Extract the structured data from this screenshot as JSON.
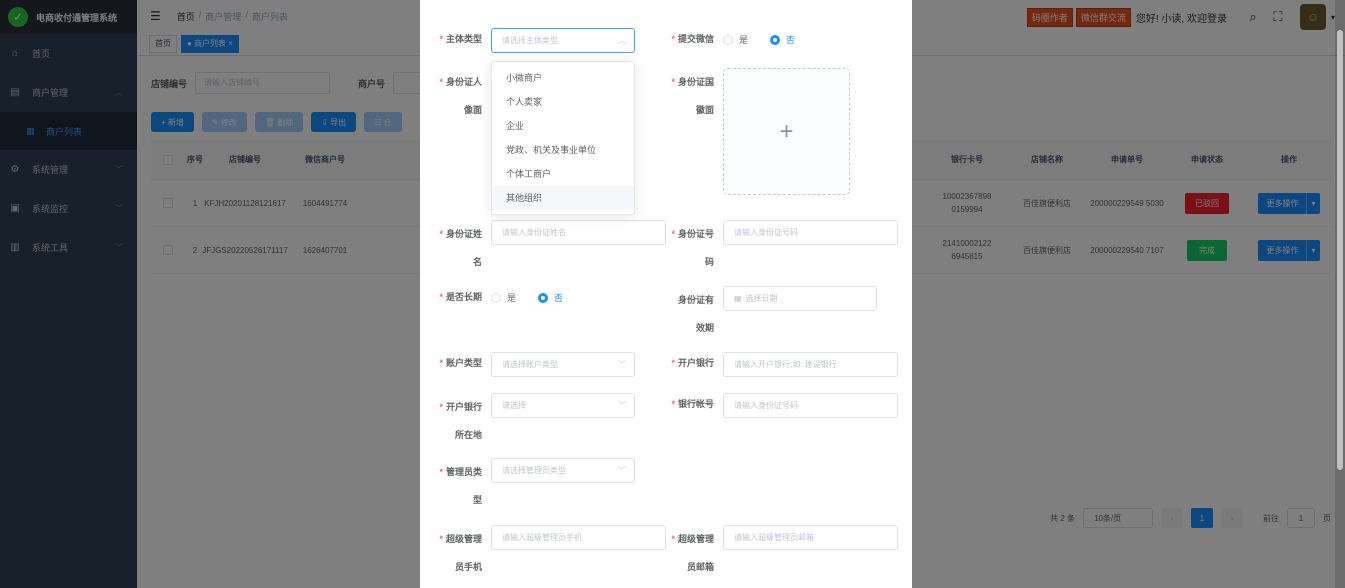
{
  "app": {
    "title": "电商收付通管理系统",
    "logo_glyph": "✓"
  },
  "sidebar": {
    "items": [
      {
        "label": "首页",
        "icon": "⌂",
        "has_arrow": false
      },
      {
        "label": "商户管理",
        "icon": "▤",
        "has_arrow": true
      },
      {
        "label": "系统管理",
        "icon": "⚙",
        "has_arrow": true
      },
      {
        "label": "系统监控",
        "icon": "▣",
        "has_arrow": true
      },
      {
        "label": "系统工具",
        "icon": "▥",
        "has_arrow": true
      }
    ],
    "active_sub": {
      "label": "商户列表",
      "icon": "▦"
    }
  },
  "navbar": {
    "breadcrumb": [
      "首页",
      "/",
      "商户管理",
      "/",
      "商户列表"
    ],
    "tag1": "码圈作者",
    "tag2": "微信群交流",
    "greeting": "您好! 小读, 欢迎登录"
  },
  "tagsview": {
    "home": "首页",
    "active": "● 商户列表 ×"
  },
  "filters": {
    "shop_label": "店铺编号",
    "shop_placeholder": "请输入店铺编号",
    "merchant_label": "商户号"
  },
  "toolbar": {
    "add": "+ 新增",
    "edit": "✎ 修改",
    "delete": "🗑 删除",
    "export": "⇩ 导出",
    "more": "☷ 合"
  },
  "table": {
    "headers": {
      "no": "序号",
      "shop": "店铺编号",
      "wx": "微信商户号",
      "bank": "银行卡号",
      "name": "店铺名称",
      "apply": "申请单号",
      "status": "申请状态",
      "op": "操作"
    },
    "rows": [
      {
        "no": "1",
        "shop": "KFJH20201128121617",
        "wx": "1604491774",
        "bank": "10002367898 0159994",
        "name": "百佳旗便利店",
        "apply": "200000229549 5030",
        "status": "已驳回",
        "status_type": "red",
        "op": "更多操作"
      },
      {
        "no": "2",
        "shop": "JFJGS20220526171117",
        "wx": "1626407701",
        "bank": "21410002122 6945815",
        "name": "百佳旗便利店",
        "apply": "200000229540 7107",
        "status": "完成",
        "status_type": "green",
        "op": "更多操作"
      }
    ]
  },
  "pagination": {
    "total": "共 2 条",
    "size": "10条/页",
    "page": "1",
    "goto_label": "前往",
    "goto_value": "1",
    "goto_unit": "页"
  },
  "dialog": {
    "subject_type": {
      "label": "主体类型",
      "placeholder": "请选择主体类型"
    },
    "submit_wx": {
      "label": "提交微信",
      "yes": "是",
      "no": "否",
      "selected": "否"
    },
    "id_front": {
      "label_a": "身份证人",
      "label_b": "像面"
    },
    "id_back": {
      "label_a": "身份证国",
      "label_b": "徽面",
      "plus": "+"
    },
    "dropdown_options": [
      "小微商户",
      "个人卖家",
      "企业",
      "党政、机关及事业单位",
      "个体工商户",
      "其他组织"
    ],
    "id_name": {
      "label_a": "身份证姓",
      "label_b": "名",
      "placeholder": "请输入身份证姓名"
    },
    "id_number": {
      "label_a": "身份证号",
      "label_b": "码",
      "placeholder": "请输入身份证号码"
    },
    "long_term": {
      "label": "是否长期",
      "yes": "是",
      "no": "否",
      "selected": "否"
    },
    "id_validity": {
      "label_a": "身份证有",
      "label_b": "效期",
      "placeholder": "选择日期"
    },
    "account_type": {
      "label": "账户类型",
      "placeholder": "请选择账户类型"
    },
    "bank": {
      "label": "开户银行",
      "placeholder": "请输入开户银行,如: 建设银行"
    },
    "bank_location": {
      "label_a": "开户银行",
      "label_b": "所在地",
      "placeholder": "请选择"
    },
    "bank_account": {
      "label": "银行帐号",
      "placeholder": "请输入身份证号码"
    },
    "admin_type": {
      "label_a": "管理员类",
      "label_b": "型",
      "placeholder": "请选择管理员类型"
    },
    "admin_phone": {
      "label_a": "超级管理",
      "label_b": "员手机",
      "placeholder": "请输入超级管理员手机"
    },
    "admin_email": {
      "label_a": "超级管理",
      "label_b": "员邮箱",
      "placeholder": "请输入超级管理员邮箱"
    }
  }
}
